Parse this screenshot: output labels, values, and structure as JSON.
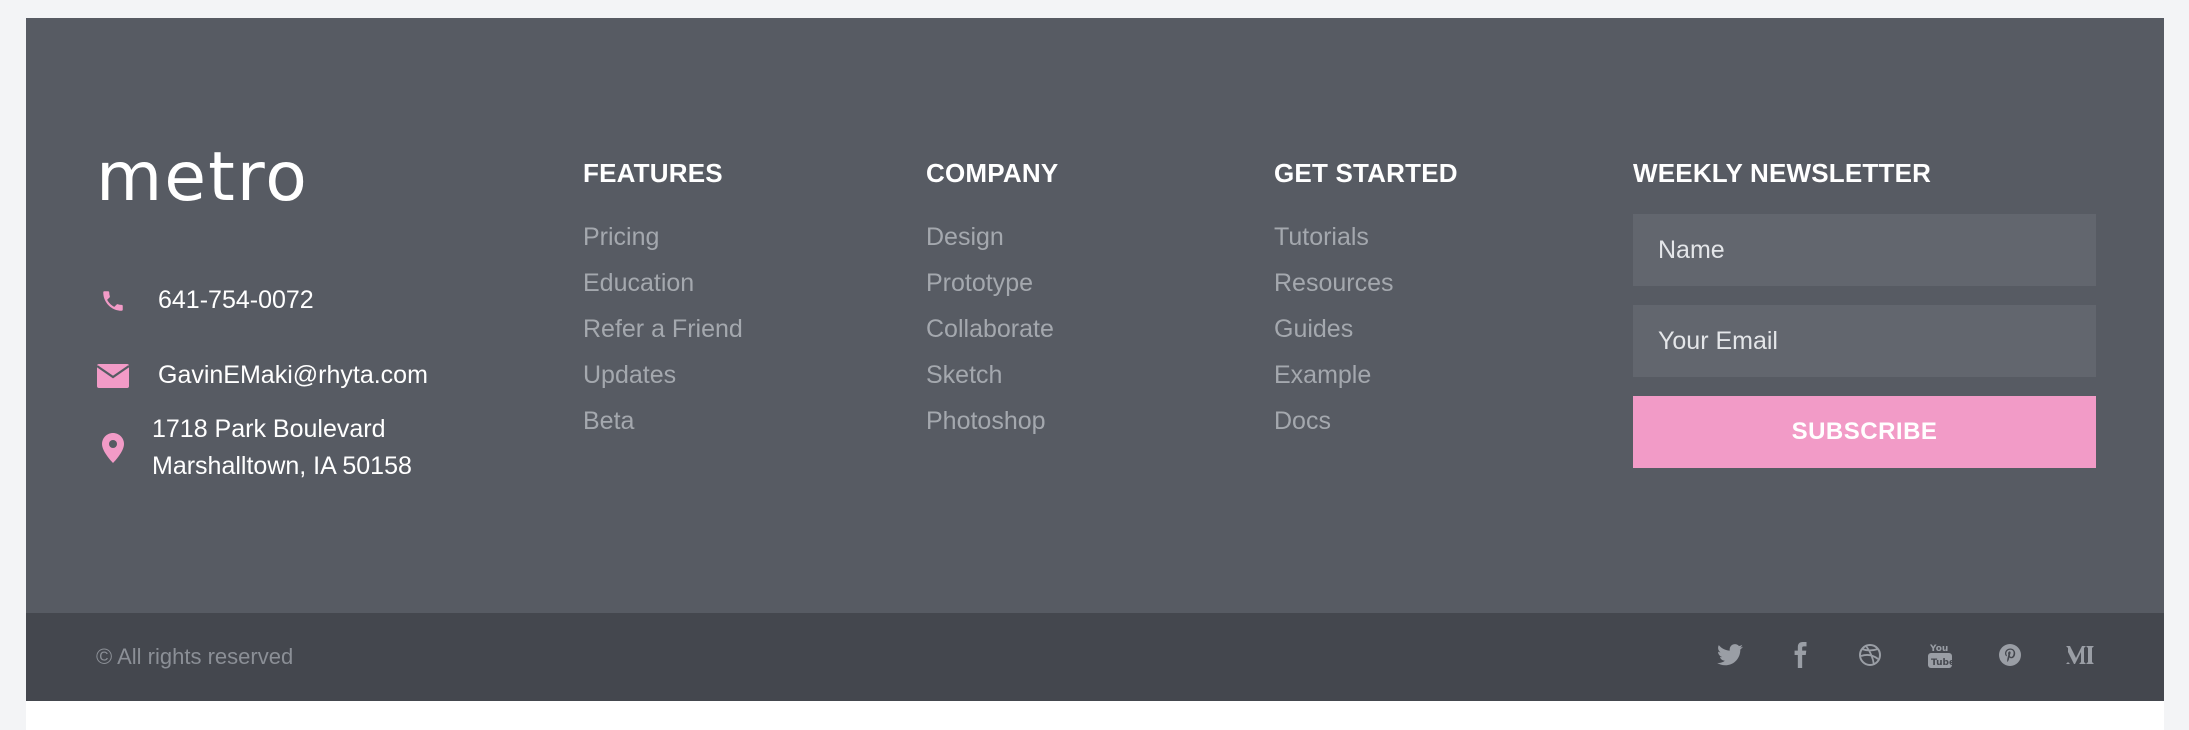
{
  "brand": {
    "name": "metro",
    "accent_color": "#f29bc7",
    "footer_bg": "#575b63",
    "footer_bottom_bg": "#44474e"
  },
  "contact": {
    "phone": "641-754-0072",
    "email": "GavinEMaki@rhyta.com",
    "address": "1718 Park Boulevard\nMarshalltown, IA 50158",
    "icons": [
      "phone-icon",
      "envelope-icon",
      "map-pin-icon"
    ]
  },
  "columns": [
    {
      "title": "FEATURES",
      "links": [
        "Pricing",
        "Education",
        "Refer a Friend",
        "Updates",
        "Beta"
      ]
    },
    {
      "title": "COMPANY",
      "links": [
        "Design",
        "Prototype",
        "Collaborate",
        "Sketch",
        "Photoshop"
      ]
    },
    {
      "title": "GET STARTED",
      "links": [
        "Tutorials",
        "Resources",
        "Guides",
        "Example",
        "Docs"
      ]
    }
  ],
  "newsletter": {
    "title": "WEEKLY NEWSLETTER",
    "name_placeholder": "Name",
    "email_placeholder": "Your Email",
    "subscribe_label": "SUBSCRIBE"
  },
  "bottom_bar": {
    "copyright": "© All rights reserved",
    "social_icons": [
      "twitter-icon",
      "facebook-icon",
      "dribbble-icon",
      "youtube-icon",
      "pinterest-icon",
      "medium-icon"
    ]
  }
}
